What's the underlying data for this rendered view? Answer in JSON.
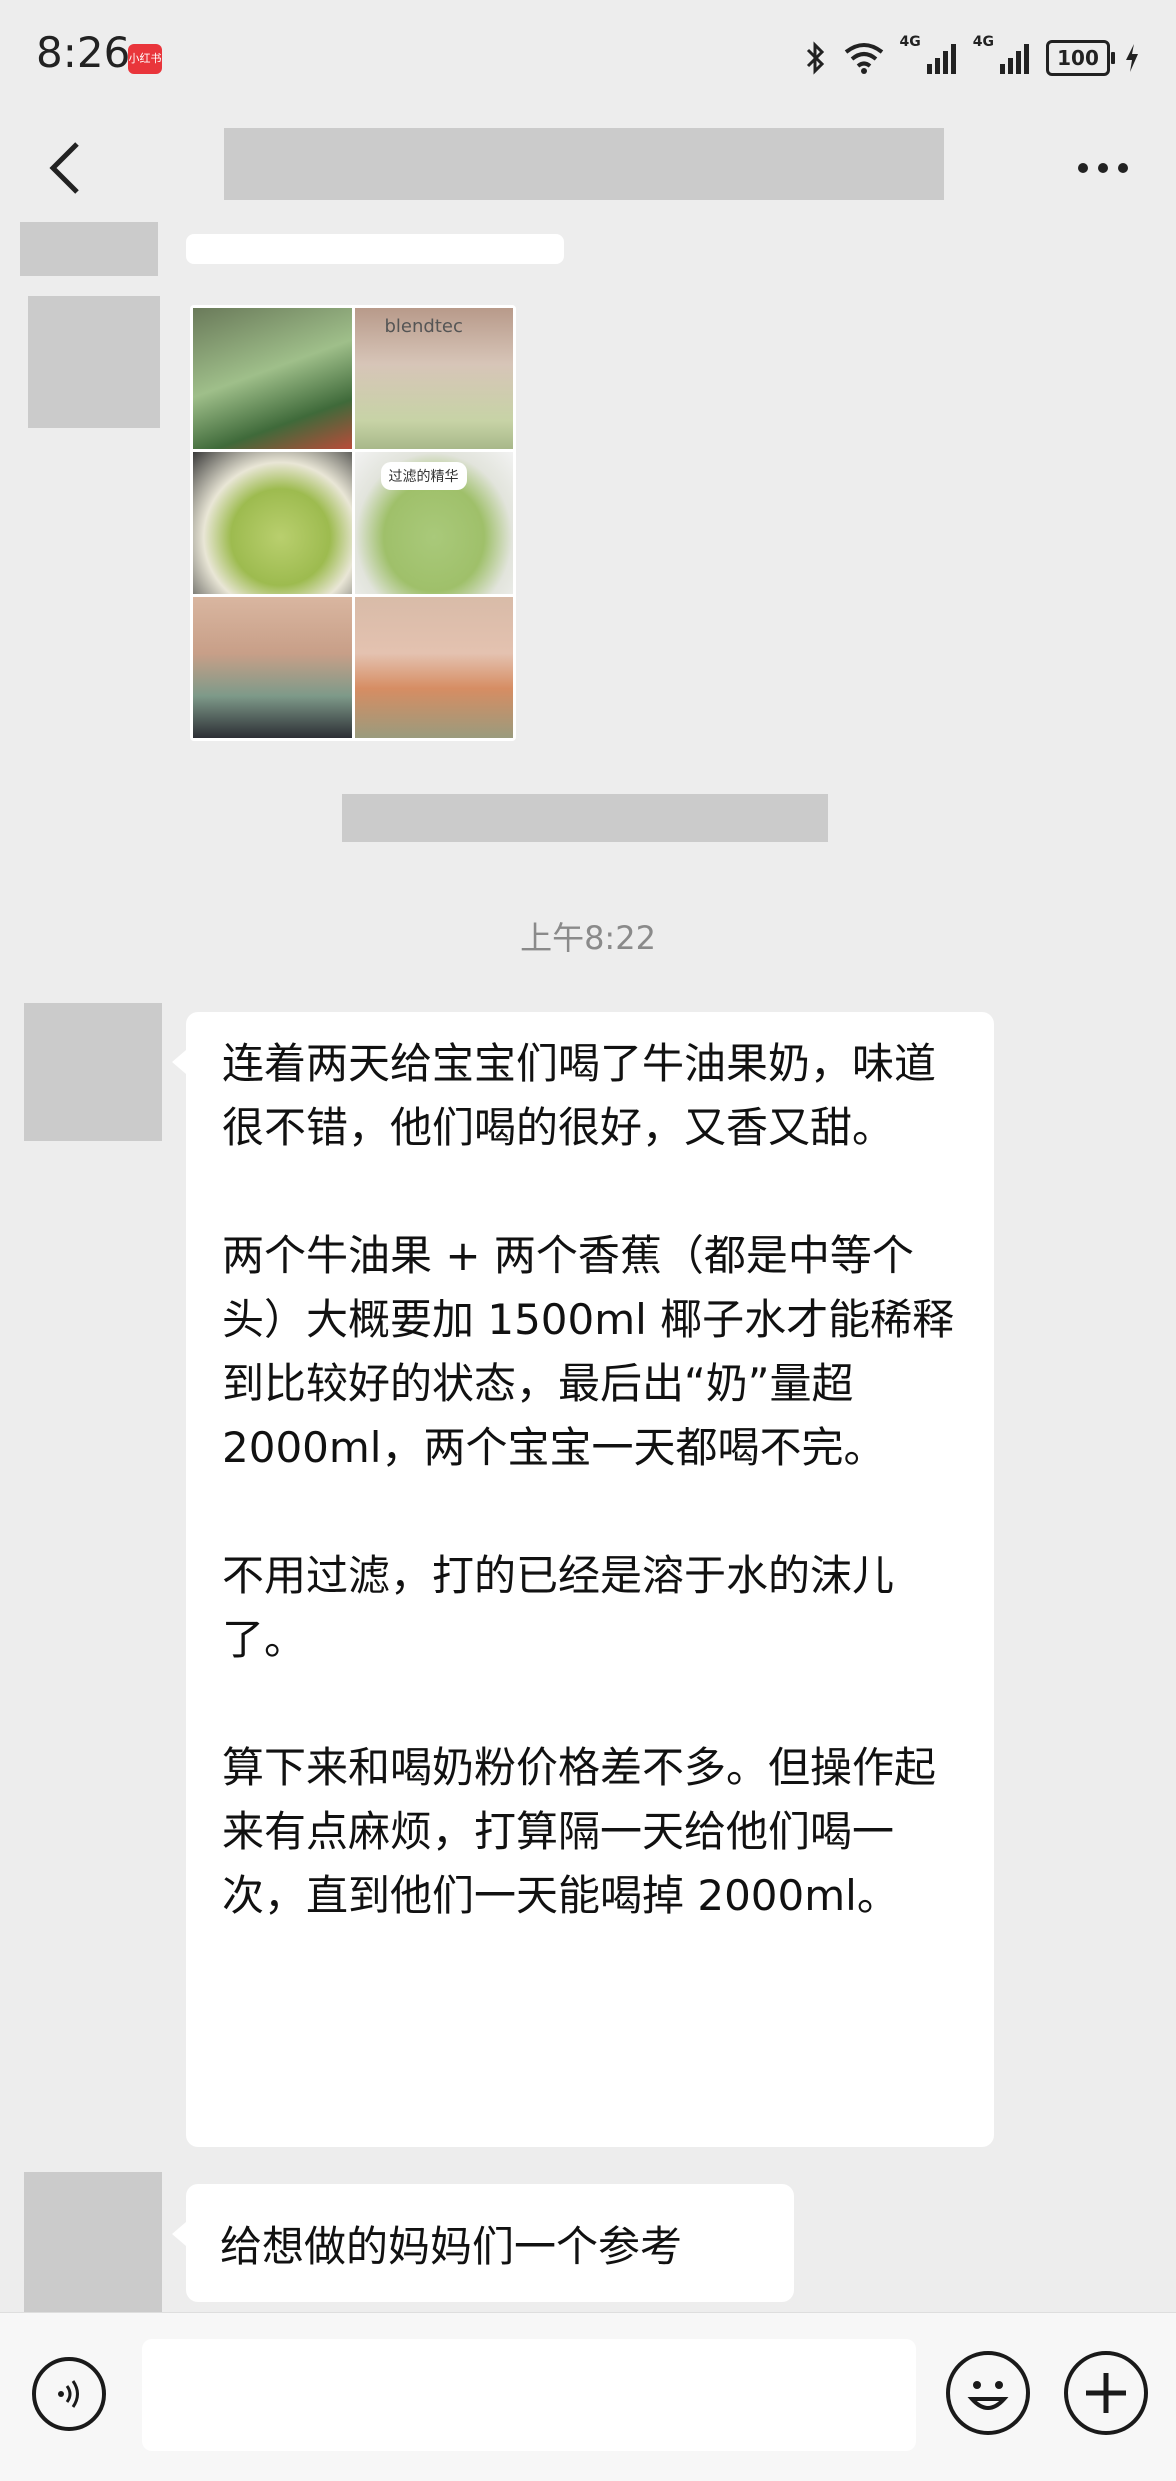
{
  "status_bar": {
    "time": "8:26",
    "app_badge": "小红书",
    "network_1": "4G",
    "network_2": "4G",
    "battery": "100"
  },
  "header": {
    "title": ""
  },
  "messages": {
    "image_caption": "过滤的精华",
    "image_brand": "blendtec",
    "timestamp": "上午8:22",
    "main_paragraphs": [
      "连着两天给宝宝们喝了牛油果奶，味道很不错，他们喝的很好，又香又甜。",
      "两个牛油果 + 两个香蕉（都是中等个头）大概要加 1500ml 椰子水才能稀释到比较好的状态，最后出“奶”量超 2000ml，两个宝宝一天都喝不完。",
      "不用过滤，打的已经是溶于水的沫儿了。",
      "算下来和喝奶粉价格差不多。但操作起来有点麻烦，打算隔一天给他们喝一次，直到他们一天能喝掉 2000ml。"
    ],
    "short_message": "给想做的妈妈们一个参考"
  },
  "input_bar": {
    "placeholder": ""
  },
  "icons": [
    "back-icon",
    "more-icon",
    "voice-icon",
    "emoji-icon",
    "plus-icon",
    "bluetooth-icon",
    "wifi-icon",
    "signal-icon",
    "charging-icon"
  ]
}
